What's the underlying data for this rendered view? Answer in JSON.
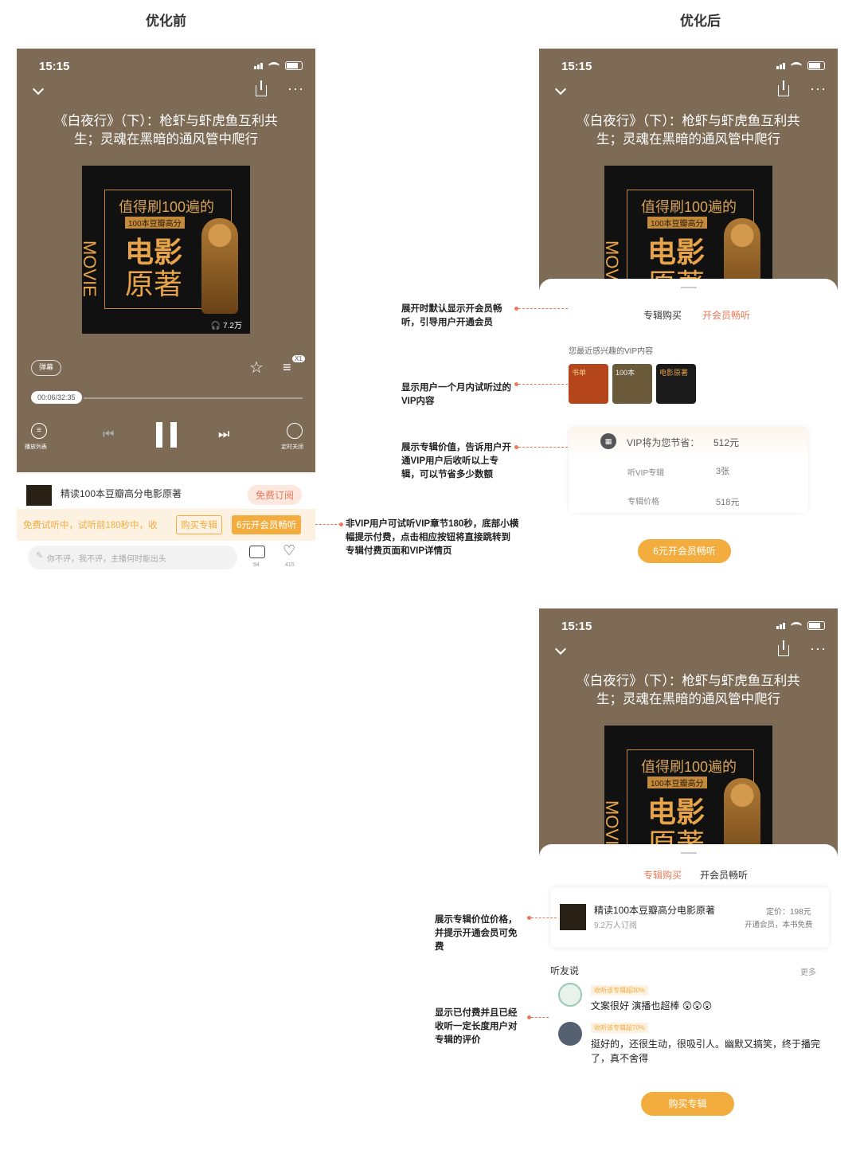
{
  "headers": {
    "before": "优化前",
    "after": "优化后"
  },
  "status": {
    "time": "15:15"
  },
  "episode_title": {
    "line1": "《白夜行》（下）：枪虾与虾虎鱼互利共",
    "line2": "生；灵魂在黑暗的通风管中爬行"
  },
  "cover": {
    "line1": "值得刷100遍的",
    "line2": "100本豆瓣高分",
    "line3": "电影",
    "line4": "原著",
    "vertical": "MOVIE",
    "plays": "7.2万"
  },
  "player": {
    "danmaku": "弹幕",
    "speed": "X1",
    "progress": "00:06/32:35",
    "progress_fraction": 0.003,
    "playlist_label": "播放列表",
    "timer_label": "定时关闭"
  },
  "before_bottom": {
    "album_name": "精读100本豆瓣高分电影原著",
    "subscribe": "免费订阅",
    "trial_text": "免费试听中，试听前180秒中，收",
    "buy_button": "购买专辑",
    "vip_button": "6元开会员畅听",
    "comment_placeholder": "你不评，我不评，主播何时能出头",
    "comment_count": "94",
    "like_count": "415"
  },
  "sheet1": {
    "tab_buy": "专辑购买",
    "tab_vip": "开会员畅听",
    "recent_label": "您最近感兴趣的VIP内容",
    "covers": [
      "书单",
      "100本",
      "电影原著"
    ],
    "save_label": "VIP将为您节省：",
    "save_value": "512元",
    "vip_album_label": "听VIP专辑",
    "vip_album_value": "3张",
    "price_label": "专辑价格",
    "price_value": "518元",
    "cta": "6元开会员畅听"
  },
  "sheet2": {
    "tab_buy": "专辑购买",
    "tab_vip": "开会员畅听",
    "album_name": "精读100本豆瓣高分电影原著",
    "album_subs": "9.2万人订阅",
    "price": "定价：198元",
    "vip_note": "开通会员，本书免费",
    "friends_label": "听友说",
    "more": "更多",
    "comments": [
      {
        "badge": "收听该专辑超30%",
        "text": "文案很好 演播也超棒"
      },
      {
        "badge": "收听该专辑超70%",
        "text": "挺好的，还很生动，很吸引人。幽默又搞笑，终于播完了，真不舍得"
      }
    ],
    "cta": "购买专辑"
  },
  "annotations": {
    "a1": "非VIP用户可试听VIP章节180秒，底部小横幅提示付费，点击相应按钮将直接跳转到专辑付费页面和VIP详情页",
    "a2": "展开时默认显示开会员畅听，引导用户开通会员",
    "a3": "显示用户一个月内试听过的VIP内容",
    "a4": "展示专辑价值，告诉用户开通VIP用户后收听以上专辑，可以节省多少数额",
    "a5": "展示专辑价位价格，并提示开通会员可免费",
    "a6": "显示已付费并且已经收听一定长度用户对专辑的评价"
  },
  "colors": {
    "bg": "#7d6b56",
    "accent": "#f2ad3e",
    "red": "#e87a5a"
  }
}
